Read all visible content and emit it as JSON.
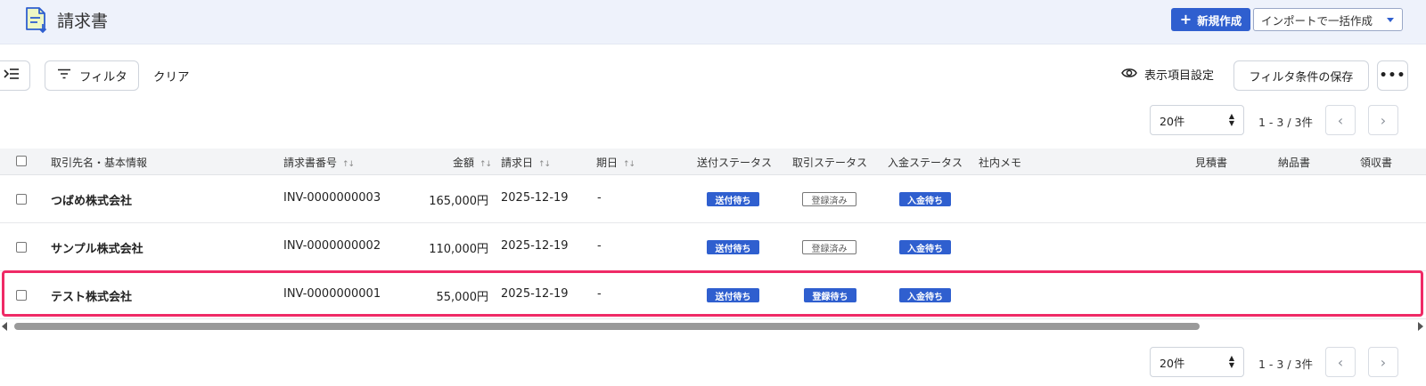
{
  "header": {
    "title": "請求書",
    "new_button": "新規作成",
    "new_icon": "plus-icon",
    "import_button": "インポートで一括作成"
  },
  "toolbar": {
    "filter_label": "フィルタ",
    "clear_label": "クリア",
    "display_settings_label": "表示項目設定",
    "save_filter_label": "フィルタ条件の保存",
    "more_label": "•••"
  },
  "pagination": {
    "per_page": "20件",
    "range": "1 - 3 / 3件",
    "prev": "‹",
    "next": "›"
  },
  "table": {
    "columns": {
      "client": "取引先名・基本情報",
      "invoice_no": "請求書番号",
      "amount": "金額",
      "invoice_date": "請求日",
      "due_date": "期日",
      "send_status": "送付ステータス",
      "deal_status": "取引ステータス",
      "payment_status": "入金ステータス",
      "memo": "社内メモ",
      "estimate": "見積書",
      "delivery": "納品書",
      "receipt": "領収書"
    },
    "sort_glyph": "↑↓",
    "rows": [
      {
        "client": "つばめ株式会社",
        "invoice_no": "INV-0000000003",
        "amount": "165,000円",
        "invoice_date": "2025-12-19",
        "due_date": "-",
        "send_status": "送付待ち",
        "deal_status": "登録済み",
        "payment_status": "入金待ち",
        "highlighted": false
      },
      {
        "client": "サンプル株式会社",
        "invoice_no": "INV-0000000002",
        "amount": "110,000円",
        "invoice_date": "2025-12-19",
        "due_date": "-",
        "send_status": "送付待ち",
        "deal_status": "登録済み",
        "payment_status": "入金待ち",
        "highlighted": false
      },
      {
        "client": "テスト株式会社",
        "invoice_no": "INV-0000000001",
        "amount": "55,000円",
        "invoice_date": "2025-12-19",
        "due_date": "-",
        "send_status": "送付待ち",
        "deal_status": "登録待ち",
        "payment_status": "入金待ち",
        "highlighted": true
      }
    ]
  },
  "colors": {
    "primary": "#2f5fcf",
    "highlight": "#ef2a66",
    "header_bg": "#eef2fb"
  }
}
